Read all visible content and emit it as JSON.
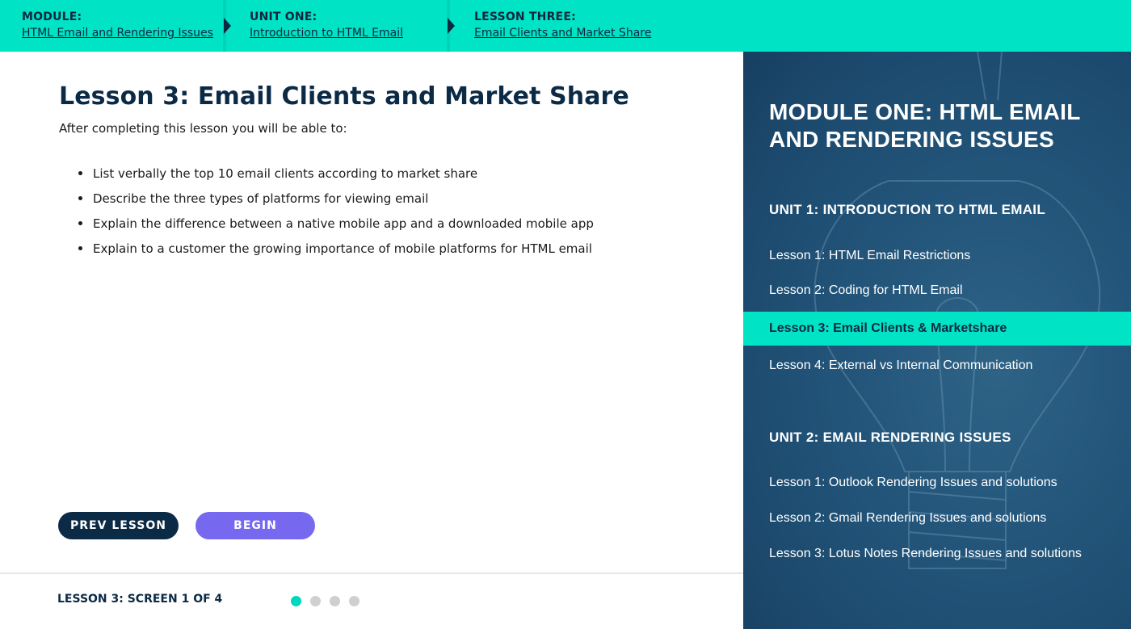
{
  "breadcrumbs": [
    {
      "kicker": "MODULE:",
      "link": "HTML Email and Rendering Issues"
    },
    {
      "kicker": "UNIT ONE:",
      "link": "Introduction to HTML Email"
    },
    {
      "kicker": "LESSON THREE:",
      "link": "Email Clients and Market Share"
    }
  ],
  "main": {
    "title": "Lesson 3: Email Clients and Market Share",
    "intro": "After completing this lesson you will be able to:",
    "objectives": [
      "List verbally the top 10 email clients according to market share",
      "Describe the three types of platforms for viewing email",
      "Explain the difference between a native mobile app and a downloaded mobile app",
      "Explain to a customer the growing importance of mobile platforms for HTML email"
    ],
    "prev_label": "PREV LESSON",
    "begin_label": "BEGIN",
    "screen_counter": "LESSON 3: SCREEN 1 OF 4",
    "pagination": {
      "total": 4,
      "current": 1
    }
  },
  "sidebar": {
    "module_title": "MODULE ONE: HTML EMAIL AND RENDERING ISSUES",
    "units": [
      {
        "heading": "UNIT 1: INTRODUCTION TO HTML EMAIL",
        "lessons": [
          "Lesson 1: HTML Email Restrictions",
          "Lesson 2: Coding for HTML Email",
          "Lesson 3: Email Clients & Marketshare",
          "Lesson 4: External vs Internal Communication"
        ],
        "active_index": 2
      },
      {
        "heading": "UNIT 2: EMAIL RENDERING ISSUES",
        "lessons": [
          "Lesson 1: Outlook Rendering Issues and solutions",
          "Lesson 2: Gmail Rendering Issues and solutions",
          "Lesson 3: Lotus Notes Rendering Issues and solutions"
        ]
      }
    ]
  },
  "colors": {
    "accent_teal": "#00e3c5",
    "navy": "#0b2a45",
    "begin_purple": "#7669f0",
    "sidebar_blue": "#1c4a6e"
  },
  "icons": [
    "chevron-right-icon",
    "bullet-icon",
    "lightbulb-background"
  ]
}
